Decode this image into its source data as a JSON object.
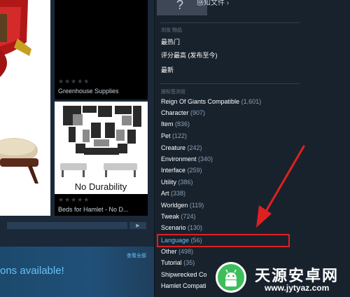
{
  "left": {
    "items": [
      {
        "title": "Greenhouse Supplies",
        "stars": "★★★★★"
      },
      {
        "title": "Beds for Hamlet - No D...",
        "stars": "★★★★★",
        "image_caption": "No Durability"
      }
    ],
    "scroll_arrow": "▶",
    "view_all": "查看全部",
    "promo": "ons available!"
  },
  "sidebar": {
    "subscribe": "感知文件 ›",
    "browse_section": "浏览 物品",
    "browse_items": [
      "最热门",
      "评分最高 (发布至今)",
      "最新"
    ],
    "tags_section": "按标签浏览",
    "tags": [
      {
        "name": "Reign Of Giants Compatible",
        "count": "(1,601)"
      },
      {
        "name": "Character",
        "count": "(907)"
      },
      {
        "name": "Item",
        "count": "(836)"
      },
      {
        "name": "Pet",
        "count": "(122)"
      },
      {
        "name": "Creature",
        "count": "(242)"
      },
      {
        "name": "Environment",
        "count": "(340)"
      },
      {
        "name": "Interface",
        "count": "(259)"
      },
      {
        "name": "Utility",
        "count": "(386)"
      },
      {
        "name": "Art",
        "count": "(338)"
      },
      {
        "name": "Worldgen",
        "count": "(119)"
      },
      {
        "name": "Tweak",
        "count": "(724)"
      },
      {
        "name": "Scenario",
        "count": "(130)"
      },
      {
        "name": "Language",
        "count": "(56)"
      },
      {
        "name": "Other",
        "count": "(498)"
      },
      {
        "name": "Tutorial",
        "count": "(35)"
      },
      {
        "name": "Shipwrecked Co",
        "count": ""
      },
      {
        "name": "Hamlet Compati",
        "count": ""
      }
    ]
  },
  "watermark": {
    "name": "天源安卓网",
    "url": "www.jytyaz.com"
  },
  "colors": {
    "highlight": "#e02020",
    "link": "#67c1f5",
    "count": "#8ba0b3"
  }
}
